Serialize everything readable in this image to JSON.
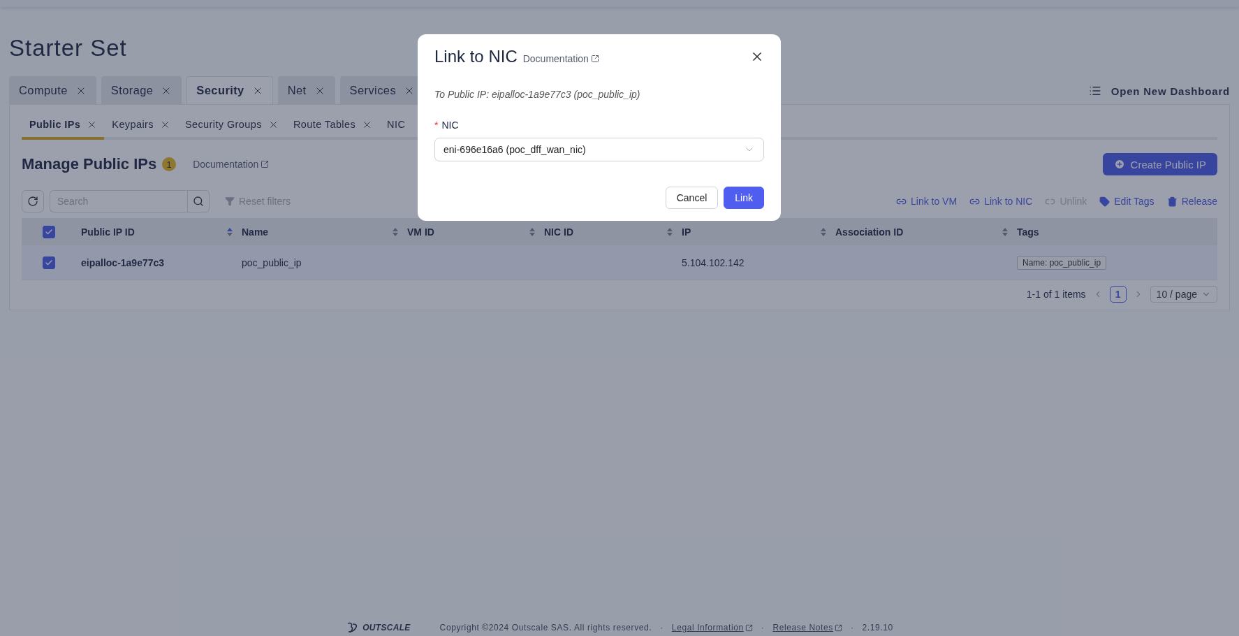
{
  "page_title": "Starter Set",
  "tabs": [
    {
      "label": "Compute",
      "selected": false
    },
    {
      "label": "Storage",
      "selected": false
    },
    {
      "label": "Security",
      "selected": true
    },
    {
      "label": "Net",
      "selected": false
    },
    {
      "label": "Services",
      "selected": false
    }
  ],
  "open_dashboard": "Open New Dashboard",
  "subtabs": [
    {
      "label": "Public IPs",
      "selected": true
    },
    {
      "label": "Keypairs",
      "selected": false
    },
    {
      "label": "Security Groups",
      "selected": false
    },
    {
      "label": "Route Tables",
      "selected": false
    },
    {
      "label": "NIC",
      "selected": false
    }
  ],
  "section": {
    "title": "Manage Public IPs",
    "badge": "1",
    "doc_link": "Documentation"
  },
  "create_button": "Create Public IP",
  "search": {
    "placeholder": "Search"
  },
  "reset_filters": {
    "label": "Reset filters",
    "disabled": true
  },
  "actions": [
    {
      "label": "Link to VM",
      "kind": "link",
      "disabled": false
    },
    {
      "label": "Link to NIC",
      "kind": "link",
      "disabled": false
    },
    {
      "label": "Unlink",
      "kind": "unlink",
      "disabled": true
    },
    {
      "label": "Edit Tags",
      "kind": "tag",
      "disabled": false
    },
    {
      "label": "Release",
      "kind": "trash",
      "disabled": false
    }
  ],
  "table": {
    "all_checked": true,
    "columns": [
      {
        "label": "Public IP ID",
        "sorted": true
      },
      {
        "label": "Name",
        "sorted": false
      },
      {
        "label": "VM ID",
        "sorted": false
      },
      {
        "label": "NIC ID",
        "sorted": false
      },
      {
        "label": "IP",
        "sorted": false
      },
      {
        "label": "Association ID",
        "sorted": false
      },
      {
        "label": "Tags"
      }
    ],
    "rows": [
      {
        "selected": true,
        "public_ip_id": "eipalloc-1a9e77c3",
        "name": "poc_public_ip",
        "ip": "5.104.102.142",
        "tags": [
          "Name: poc_public_ip"
        ]
      }
    ]
  },
  "pagination": {
    "summary": "1-1 of 1 items",
    "pages": [
      {
        "label": "1",
        "selected": true
      }
    ],
    "page_size": "10 / page"
  },
  "footer": {
    "logo_text": "OUTSCALE",
    "items": [
      {
        "kind": "text",
        "text": "Copyright ©2024 Outscale SAS. All rights reserved."
      },
      {
        "kind": "separator",
        "text": "·"
      },
      {
        "kind": "link",
        "text": "Legal Information"
      },
      {
        "kind": "separator",
        "text": "·"
      },
      {
        "kind": "link",
        "text": "Release Notes"
      },
      {
        "kind": "separator",
        "text": "·"
      },
      {
        "kind": "text",
        "text": "2.19.10"
      }
    ]
  },
  "modal": {
    "title": "Link to NIC",
    "doc_link": "Documentation",
    "subtitle": "To Public IP: eipalloc-1a9e77c3 (poc_public_ip)",
    "field": {
      "label": "NIC",
      "required_mark": "*",
      "value": "eni-696e16a6 (poc_dff_wan_nic)"
    },
    "buttons": [
      {
        "label": "Cancel",
        "kind": "default"
      },
      {
        "label": "Link",
        "kind": "primary"
      }
    ]
  }
}
